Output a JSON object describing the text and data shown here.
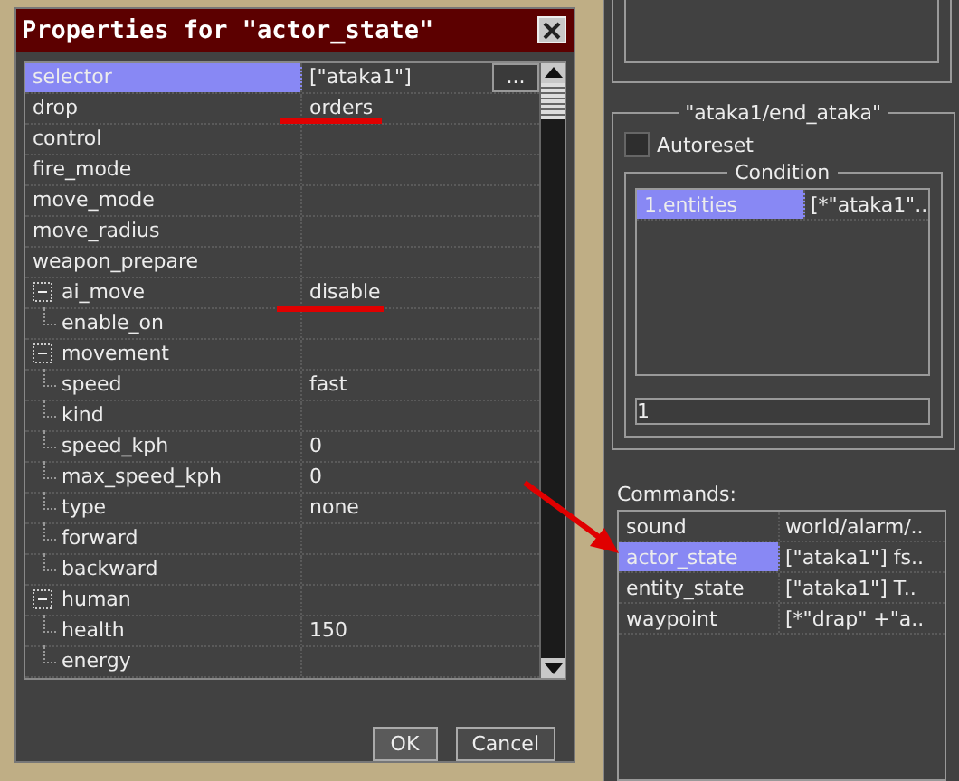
{
  "dialog": {
    "title": "Properties for \"actor_state\"",
    "properties": [
      {
        "name": "selector",
        "value": "[\"ataka1\"]",
        "selected": true,
        "browse_button": "..."
      },
      {
        "name": "drop",
        "value": "orders",
        "selected": false
      },
      {
        "name": "control",
        "selected": false
      },
      {
        "name": "fire_mode",
        "selected": false
      },
      {
        "name": "move_mode",
        "selected": false
      },
      {
        "name": "move_radius",
        "selected": false
      },
      {
        "name": "weapon_prepare",
        "selected": false
      },
      {
        "name": "ai_move",
        "value": "disable",
        "selected": false,
        "expanded": true,
        "children": [
          {
            "name": "enable_on",
            "selected": false
          }
        ]
      },
      {
        "name": "movement",
        "selected": false,
        "expanded": true,
        "children": [
          {
            "name": "speed",
            "value": "fast",
            "selected": false
          },
          {
            "name": "kind",
            "selected": false
          },
          {
            "name": "speed_kph",
            "value": "0",
            "selected": false
          },
          {
            "name": "max_speed_kph",
            "value": "0",
            "selected": false
          },
          {
            "name": "type",
            "value": "none",
            "selected": false
          },
          {
            "name": "forward",
            "selected": false
          },
          {
            "name": "backward",
            "selected": false
          }
        ]
      },
      {
        "name": "human",
        "selected": false,
        "expanded": true,
        "children": [
          {
            "name": "health",
            "value": "150",
            "selected": false
          },
          {
            "name": "energy",
            "selected": false
          }
        ]
      }
    ],
    "buttons": [
      "OK",
      "Cancel"
    ]
  },
  "trigger_panel": {
    "title": "\"ataka1/end_ataka\"",
    "autoreset": {
      "label": "Autoreset",
      "checked": false
    },
    "condition": {
      "title": "Condition",
      "rows": [
        {
          "name": "1.entities",
          "value": "[*\"ataka1\"..",
          "selected": true
        }
      ],
      "field_value": "1"
    },
    "commands_label": "Commands:",
    "commands": [
      {
        "name": "sound",
        "value": "world/alarm/..",
        "selected": false
      },
      {
        "name": "actor_state",
        "value": "[\"ataka1\"] fs..",
        "selected": true
      },
      {
        "name": "entity_state",
        "value": "[\"ataka1\"] T..",
        "selected": false
      },
      {
        "name": "waypoint",
        "value": "[*\"drap\" +\"a..",
        "selected": false
      }
    ]
  }
}
